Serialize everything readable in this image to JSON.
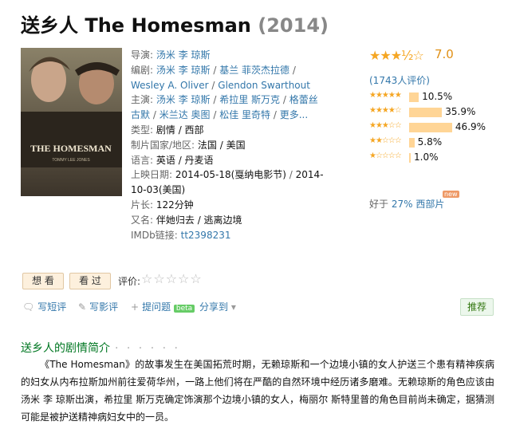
{
  "title": {
    "name": "送乡人 The Homesman",
    "year": "(2014)"
  },
  "poster": {
    "title_text": "THE HOMESMAN",
    "credit_text": "TOMMY LEE JONES"
  },
  "info": {
    "director_label": "导演:",
    "director": "汤米 李 琼斯",
    "writer_label": "编剧:",
    "writer_1": "汤米 李 琼斯",
    "writer_2": "基兰 菲茨杰拉德",
    "writer_3": "Wesley A. Oliver",
    "writer_4": "Glendon Swarthout",
    "cast_label": "主演:",
    "cast_1": "汤米 李 琼斯",
    "cast_2": "希拉里 斯万克",
    "cast_3": "格蕾丝 古默",
    "cast_4": "米兰达 奥图",
    "cast_5": "松佳 里奇特",
    "cast_more": "更多...",
    "genre_label": "类型:",
    "genre": "剧情 / 西部",
    "country_label": "制片国家/地区:",
    "country": "法国 / 美国",
    "lang_label": "语言:",
    "lang": "英语 / 丹麦语",
    "release_label": "上映日期:",
    "release_1": "2014-05-18(戛纳电影节)",
    "release_2": "2014-10-03(美国)",
    "runtime_label": "片长:",
    "runtime": "122分钟",
    "aka_label": "又名:",
    "aka": "伴她归去 / 逃离边境",
    "imdb_label": "IMDb链接:",
    "imdb": "tt2398231"
  },
  "rating": {
    "stars": "★★★½☆",
    "score": "7.0",
    "votes": "(1743人评价)",
    "dist": [
      {
        "stars": "★★★★★",
        "pct_text": "10.5%",
        "pct": 10.5
      },
      {
        "stars": "★★★★☆",
        "pct_text": "35.9%",
        "pct": 35.9
      },
      {
        "stars": "★★★☆☆",
        "pct_text": "46.9%",
        "pct": 46.9
      },
      {
        "stars": "★★☆☆☆",
        "pct_text": "5.8%",
        "pct": 5.8
      },
      {
        "stars": "★☆☆☆☆",
        "pct_text": "1.0%",
        "pct": 1.0
      }
    ],
    "better_prefix": "好于",
    "better_link": "27% 西部片",
    "better_new": "new"
  },
  "buttons": {
    "want": "想 看",
    "seen": "看 过",
    "rate_label": "评价:",
    "rate_stars": "☆☆☆☆☆"
  },
  "actions": {
    "short_review": "写短评",
    "review": "写影评",
    "ask": "提问题",
    "beta": "beta",
    "share": "分享到",
    "recommend": "推荐"
  },
  "summary": {
    "heading": "送乡人的剧情简介",
    "dots": "· · · · · ·",
    "text": "《The Homesman》的故事发生在美国拓荒时期，无赖琼斯和一个边境小镇的女人护送三个患有精神疾病的妇女从内布拉斯加州前往爱荷华州，一路上他们将在严酷的自然环境中经历诸多磨难。无赖琼斯的角色应该由汤米 李 琼斯出演，希拉里 斯万克确定饰演那个边境小镇的女人，梅丽尔 斯特里普的角色目前尚未确定，据猜测可能是被护送精神病妇女中的一员。"
  }
}
